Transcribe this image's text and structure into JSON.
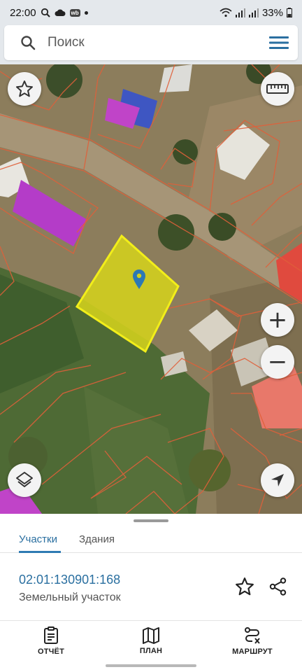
{
  "status_bar": {
    "time": "22:00",
    "notification_badge": "wb",
    "battery": "33%"
  },
  "search": {
    "placeholder": "Поиск"
  },
  "map_controls": {
    "favorites_icon": "star-icon",
    "ruler_icon": "ruler-icon",
    "zoom_in": "+",
    "zoom_out": "−",
    "layers_icon": "layers-icon",
    "locate_icon": "navigation-arrow-icon"
  },
  "sheet": {
    "tabs": [
      {
        "label": "Участки",
        "active": true
      },
      {
        "label": "Здания",
        "active": false
      }
    ],
    "parcel": {
      "cadastral_number": "02:01:130901:168",
      "type": "Земельный участок"
    }
  },
  "bottom_nav": {
    "items": [
      {
        "label": "ОТЧЁТ",
        "icon": "report-icon"
      },
      {
        "label": "ПЛАН",
        "icon": "map-icon"
      },
      {
        "label": "МАРШРУТ",
        "icon": "route-icon"
      }
    ]
  },
  "colors": {
    "accent": "#2a6fa0",
    "selected_parcel_fill": "#d4d21c",
    "selected_parcel_stroke": "#f2ee1a",
    "parcel_boundary": "#e0603a",
    "building_magenta": "#b43cc8",
    "building_red": "#e8483a"
  }
}
